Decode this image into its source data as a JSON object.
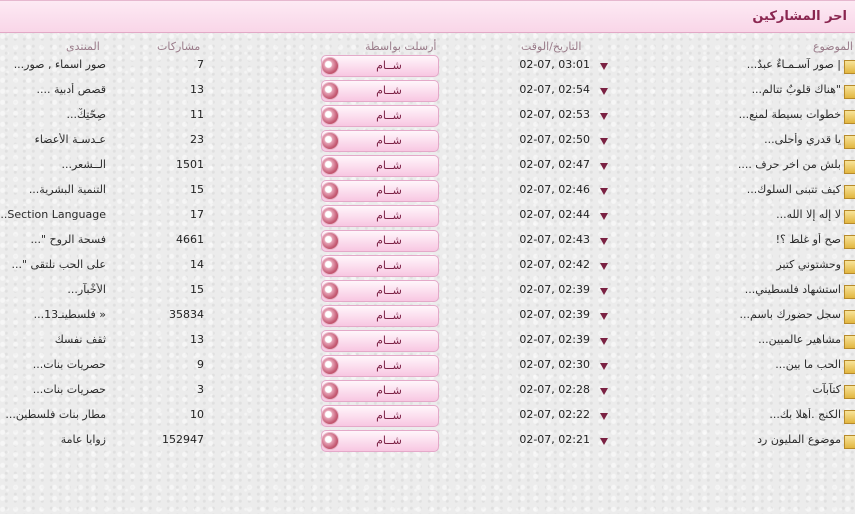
{
  "header": {
    "title": "احر المشاركين"
  },
  "columns": {
    "topic": "الموضوع",
    "datetime": "التاريخ/الوقت",
    "sent_by": "أرسلت بواسطة",
    "posts": "مشاركات",
    "forum": "المنتدى"
  },
  "rows": [
    {
      "topic": "| صور آسـمـاءٌ عبدٌ...",
      "datetime": "02-07, 03:01",
      "author": "شــام",
      "posts": "7",
      "forum": "صور اسماء , صور..."
    },
    {
      "topic": "\"هناك قلوبٌ تتالم...",
      "datetime": "02-07, 02:54",
      "author": "شــام",
      "posts": "13",
      "forum": "قصص أدبية ...."
    },
    {
      "topic": "خطوات بسيطة لمنع...",
      "datetime": "02-07, 02:53",
      "author": "شــام",
      "posts": "11",
      "forum": "صِحّتِكْ..."
    },
    {
      "topic": "يا قدري وأحلى...",
      "datetime": "02-07, 02:50",
      "author": "شــام",
      "posts": "23",
      "forum": "عـدسـة الأعضاء"
    },
    {
      "topic": "بلش من اخر حرف ....",
      "datetime": "02-07, 02:47",
      "author": "شــام",
      "posts": "1501",
      "forum": "الــشعر..."
    },
    {
      "topic": "كيف تتبنى السلوك...",
      "datetime": "02-07, 02:46",
      "author": "شــام",
      "posts": "15",
      "forum": "التنمية البشرية..."
    },
    {
      "topic": "لا إله إلا الله...",
      "datetime": "02-07, 02:44",
      "author": "شــام",
      "posts": "17",
      "forum": "Section Language..."
    },
    {
      "topic": "صح أو غلط ؟!",
      "datetime": "02-07, 02:43",
      "author": "شــام",
      "posts": "4661",
      "forum": "فسحة الروح \"..."
    },
    {
      "topic": "وحشتوني كتير",
      "datetime": "02-07, 02:42",
      "author": "شــام",
      "posts": "14",
      "forum": "على الحب نلتقى \"..."
    },
    {
      "topic": "استشهاد فلسطيني...",
      "datetime": "02-07, 02:39",
      "author": "شــام",
      "posts": "15",
      "forum": "الأخْبآر..."
    },
    {
      "topic": "سجل حضورك باسم...",
      "datetime": "02-07, 02:39",
      "author": "شــام",
      "posts": "35834",
      "forum": "« فلسطينـ13..."
    },
    {
      "topic": "مشاهير عالميين...",
      "datetime": "02-07, 02:39",
      "author": "شــام",
      "posts": "13",
      "forum": "ثقف نفسك"
    },
    {
      "topic": "الحب ما بين...",
      "datetime": "02-07, 02:30",
      "author": "شــام",
      "posts": "9",
      "forum": "حصريات بنات..."
    },
    {
      "topic": "كتآبآت",
      "datetime": "02-07, 02:28",
      "author": "شــام",
      "posts": "3",
      "forum": "حصريات بنات..."
    },
    {
      "topic": "الكنج .أهلا بك...",
      "datetime": "02-07, 02:22",
      "author": "شــام",
      "posts": "10",
      "forum": "مطار بنات فلسطين..."
    },
    {
      "topic": "موضوع المليون رد",
      "datetime": "02-07, 02:21",
      "author": "شــام",
      "posts": "152947",
      "forum": "زوايا عامة"
    }
  ],
  "colors": {
    "accent": "#8a2650",
    "pill": "#f8c7e2",
    "arrow": "#7a2142"
  },
  "icons": {
    "row_folder": "folder-icon",
    "row_arrow": "dropdown-arrow-icon",
    "avatar": "user-avatar-icon"
  }
}
